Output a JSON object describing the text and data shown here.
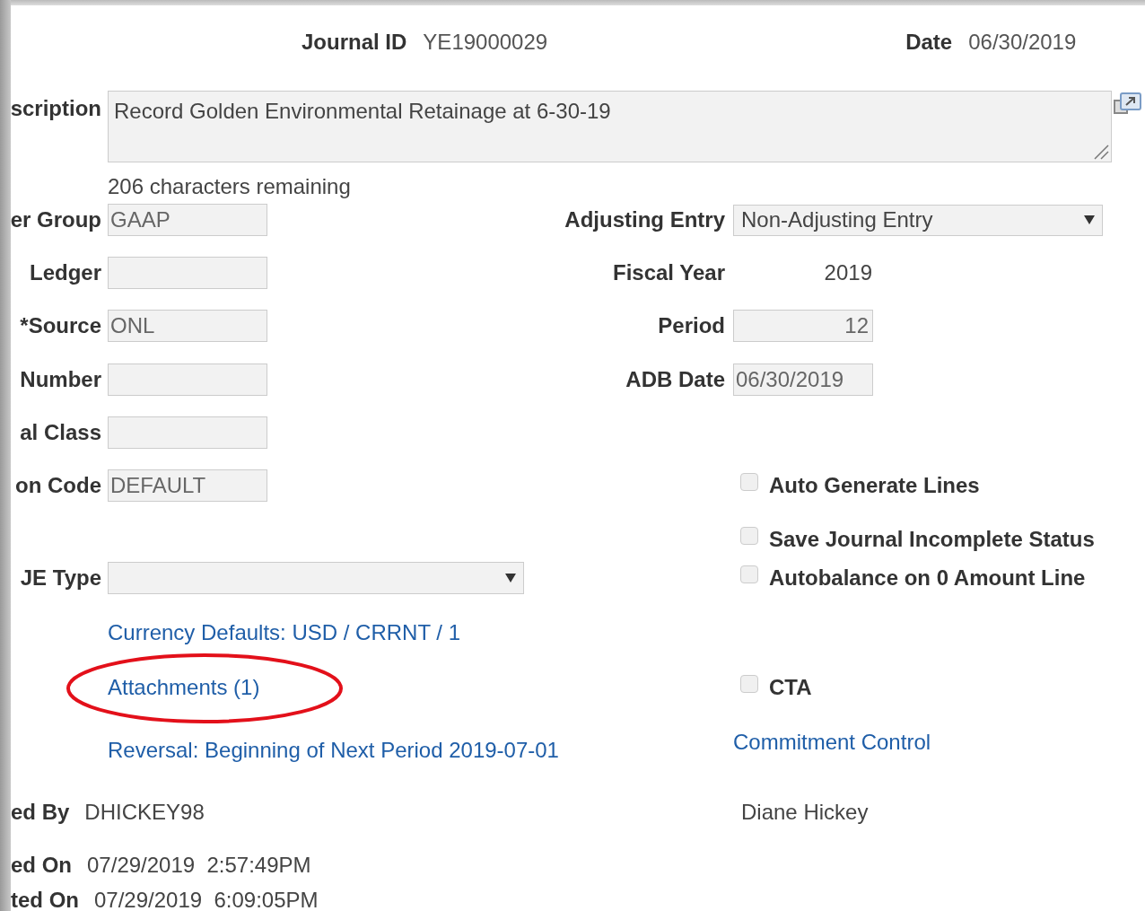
{
  "header": {
    "journal_id": {
      "label": "Journal ID",
      "value": "YE19000029"
    },
    "date": {
      "label": "Date",
      "value": "06/30/2019"
    }
  },
  "description": {
    "label": "scription",
    "value": "Record Golden Environmental Retainage at 6-30-19",
    "note": "206 characters remaining"
  },
  "rows": [
    {
      "left": {
        "kind": "field",
        "label": "er Group",
        "value": "GAAP"
      },
      "right": {
        "kind": "select",
        "label": "Adjusting Entry",
        "value": "Non-Adjusting Entry"
      }
    },
    {
      "left": {
        "kind": "field",
        "label": "Ledger"
      },
      "right": {
        "kind": "value",
        "label": "Fiscal Year",
        "value": "2019"
      }
    },
    {
      "left": {
        "kind": "field",
        "label": "*Source",
        "value": "ONL"
      },
      "right": {
        "kind": "number",
        "label": "Period",
        "value": "12"
      }
    },
    {
      "left": {
        "kind": "field",
        "label": "Number"
      },
      "right": {
        "kind": "field",
        "label": "ADB Date",
        "value": "06/30/2019"
      }
    },
    {
      "left": {
        "kind": "field",
        "label": "al Class"
      }
    },
    {
      "left": {
        "kind": "field",
        "label": "on Code",
        "value": "DEFAULT"
      },
      "right": {
        "kind": "checkbox",
        "label": "Auto Generate Lines",
        "checked": false
      }
    },
    {
      "right": {
        "kind": "checkbox",
        "label": "Save Journal Incomplete Status",
        "checked": false
      }
    },
    {
      "left": {
        "kind": "select",
        "label": "JE Type"
      },
      "right": {
        "kind": "checkbox",
        "label": "Autobalance on 0 Amount Line",
        "checked": false
      }
    },
    {
      "left": {
        "kind": "link",
        "label": "Currency Defaults: USD / CRRNT / 1",
        "circled": false
      }
    },
    {
      "left": {
        "kind": "link",
        "label": "Attachments (1)",
        "circled": true
      },
      "right": {
        "kind": "checkbox",
        "label": "CTA",
        "checked": false
      }
    },
    {
      "left": {
        "kind": "link",
        "label": "Reversal: Beginning of Next Period 2019-07-01",
        "circled": false
      },
      "right": {
        "kind": "link",
        "label": "Commitment Control"
      }
    },
    {
      "left": {
        "kind": "info",
        "label": "ed By",
        "value": "DHICKEY98"
      },
      "right": {
        "kind": "text",
        "value": "Diane Hickey"
      }
    },
    {
      "left": {
        "kind": "info",
        "label": "ed On",
        "value": "07/29/2019  2:57:49PM"
      }
    },
    {
      "left": {
        "kind": "info",
        "label": "ted On",
        "value": "07/29/2019  6:09:05PM"
      }
    }
  ]
}
